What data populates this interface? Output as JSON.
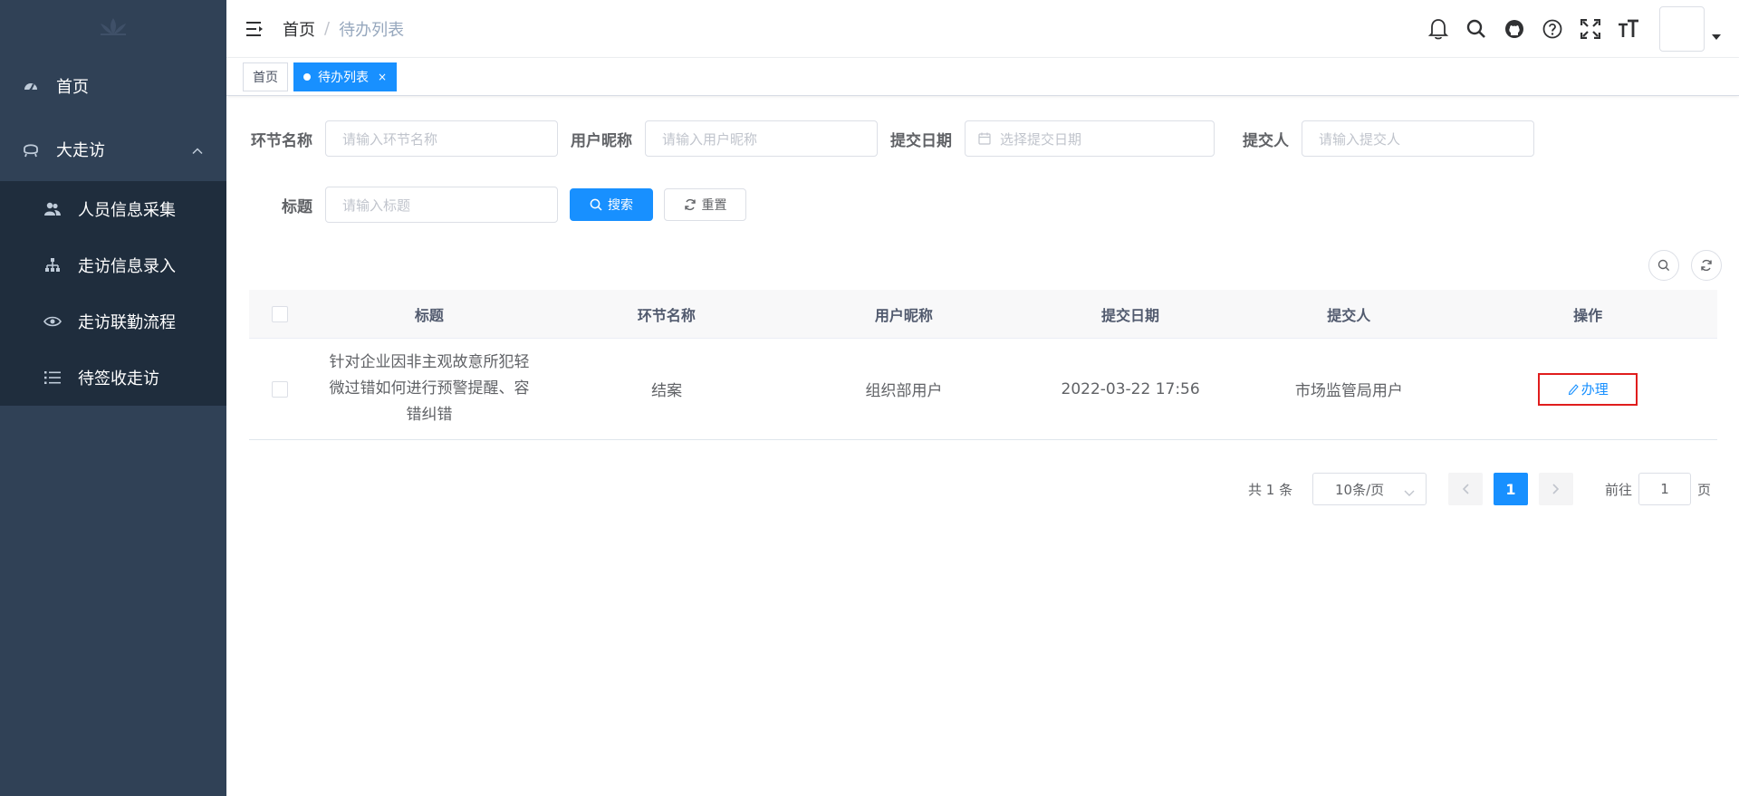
{
  "sidebar": {
    "items": [
      {
        "label": "首页",
        "icon": "dashboard-icon"
      },
      {
        "label": "大走访",
        "icon": "visit-icon",
        "expanded": true,
        "children": [
          {
            "label": "人员信息采集",
            "icon": "users-icon"
          },
          {
            "label": "走访信息录入",
            "icon": "tree-icon"
          },
          {
            "label": "走访联勤流程",
            "icon": "eye-icon"
          },
          {
            "label": "待签收走访",
            "icon": "list-icon"
          }
        ]
      }
    ]
  },
  "navbar": {
    "breadcrumb": {
      "home": "首页",
      "separator": "/",
      "current": "待办列表"
    }
  },
  "tags": [
    {
      "label": "首页",
      "active": false
    },
    {
      "label": "待办列表",
      "active": true,
      "close": "×"
    }
  ],
  "search": {
    "node_name_label": "环节名称",
    "node_name_placeholder": "请输入环节名称",
    "nickname_label": "用户昵称",
    "nickname_placeholder": "请输入用户昵称",
    "date_label": "提交日期",
    "date_placeholder": "选择提交日期",
    "submitter_label": "提交人",
    "submitter_placeholder": "请输入提交人",
    "title_label": "标题",
    "title_placeholder": "请输入标题",
    "search_button": "搜索",
    "reset_button": "重置"
  },
  "table": {
    "columns": [
      "标题",
      "环节名称",
      "用户昵称",
      "提交日期",
      "提交人",
      "操作"
    ],
    "rows": [
      {
        "title_line1": "针对企业因非主观故意所犯轻",
        "title_line2": "微过错如何进行预警提醒、容",
        "title_line3": "错纠错",
        "node_name": "结案",
        "nickname": "组织部用户",
        "submit_date": "2022-03-22 17:56",
        "submitter": "市场监管局用户",
        "action": "办理"
      }
    ]
  },
  "pagination": {
    "total": "共 1 条",
    "page_size": "10条/页",
    "current_page": "1",
    "goto_label": "前往",
    "goto_value": "1",
    "goto_suffix": "页"
  },
  "colors": {
    "sidebar_bg": "#304156",
    "submenu_bg": "#1f2d3d",
    "primary": "#1890ff",
    "highlight_border": "#e01d1d"
  }
}
